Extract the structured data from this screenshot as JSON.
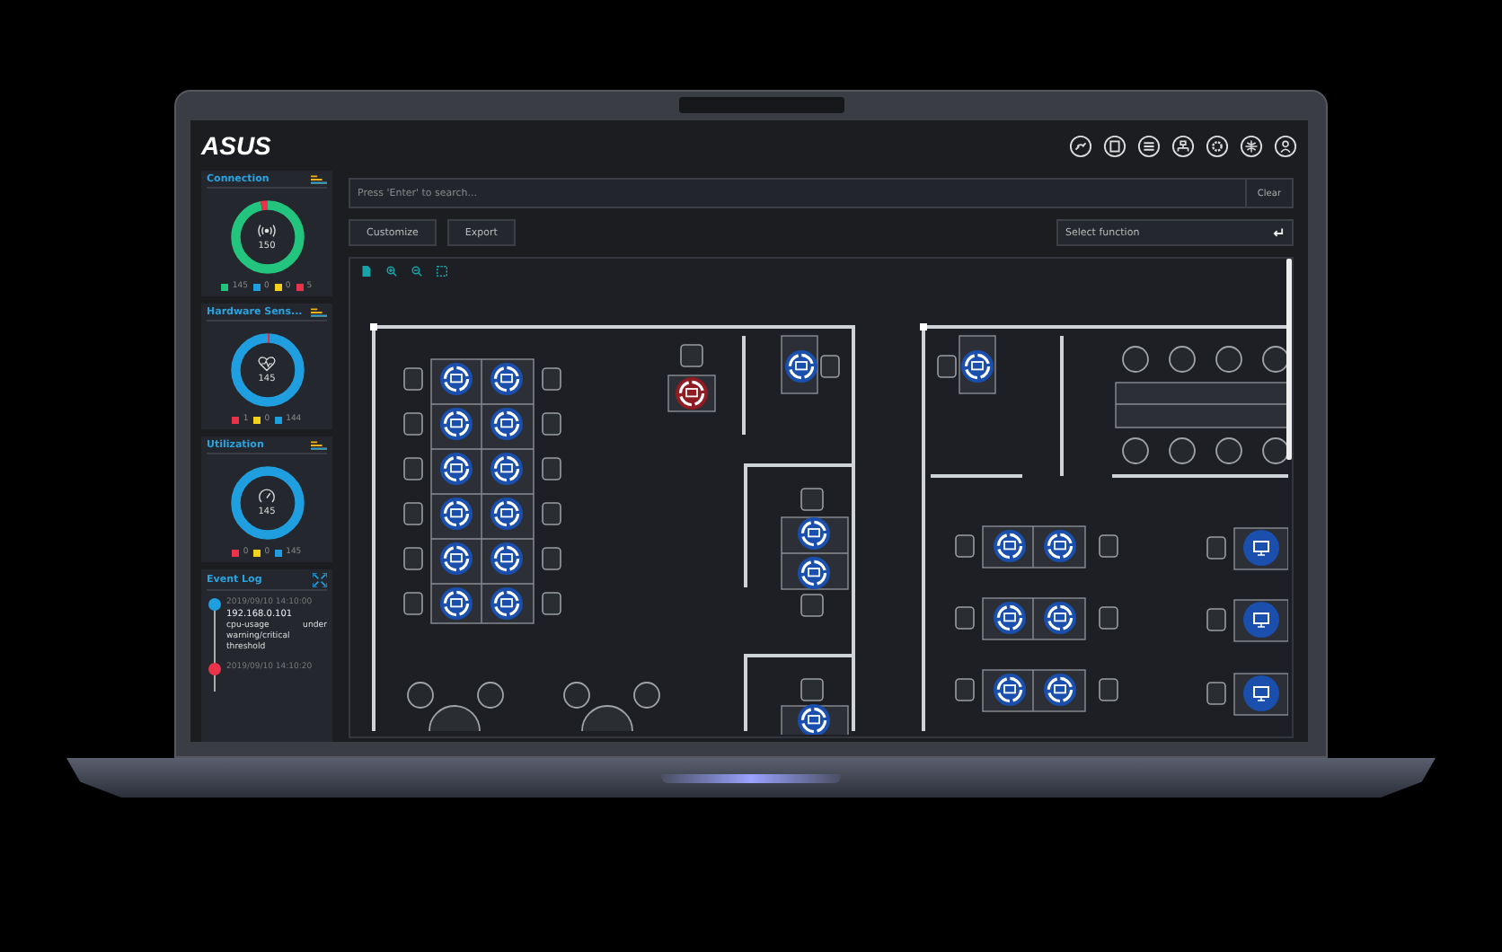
{
  "logo": "ASUS",
  "sidebar": {
    "cards": [
      {
        "kind": "connection",
        "title": "Connection",
        "total": "150",
        "legend": [
          {
            "color": "#22c47e",
            "value": "145"
          },
          {
            "color": "#1f9fe0",
            "value": "0"
          },
          {
            "color": "#f2d21b",
            "value": "0"
          },
          {
            "color": "#e8334a",
            "value": "5"
          }
        ]
      },
      {
        "kind": "hardware",
        "title": "Hardware Sens...",
        "total": "145",
        "legend": [
          {
            "color": "#e8334a",
            "value": "1"
          },
          {
            "color": "#f2d21b",
            "value": "0"
          },
          {
            "color": "#1f9fe0",
            "value": "144"
          }
        ]
      },
      {
        "kind": "utilization",
        "title": "Utilization",
        "total": "145",
        "legend": [
          {
            "color": "#e8334a",
            "value": "0"
          },
          {
            "color": "#f2d21b",
            "value": "0"
          },
          {
            "color": "#1f9fe0",
            "value": "145"
          }
        ]
      }
    ],
    "event_log": {
      "title": "Event Log",
      "events": [
        {
          "color": "#1f9fe0",
          "time": "2019/09/10 14:10:00",
          "host": "192.168.0.101",
          "message": "cpu-usage under warning/critical threshold"
        },
        {
          "color": "#e8334a",
          "time": "2019/09/10 14:10:20"
        }
      ]
    }
  },
  "search": {
    "placeholder": "Press 'Enter' to search...",
    "button": "Clear"
  },
  "buttons": [
    "Customize",
    "Export"
  ],
  "select": {
    "placeholder": "Select function"
  },
  "floor_plan": {
    "devices": [
      {
        "kind": "workstation",
        "alert": false
      },
      {
        "kind": "workstation",
        "alert": false
      },
      {
        "kind": "workstation",
        "alert": false
      },
      {
        "kind": "workstation",
        "alert": false
      },
      {
        "kind": "workstation",
        "alert": false
      },
      {
        "kind": "workstation",
        "alert": false
      },
      {
        "kind": "workstation",
        "alert": false
      },
      {
        "kind": "workstation",
        "alert": false
      },
      {
        "kind": "workstation",
        "alert": false
      },
      {
        "kind": "workstation",
        "alert": false
      },
      {
        "kind": "workstation",
        "alert": false
      },
      {
        "kind": "workstation",
        "alert": false
      },
      {
        "kind": "workstation",
        "alert": true
      },
      {
        "kind": "workstation",
        "alert": false
      },
      {
        "kind": "workstation",
        "alert": false
      },
      {
        "kind": "workstation",
        "alert": false
      },
      {
        "kind": "workstation",
        "alert": false
      },
      {
        "kind": "workstation",
        "alert": false
      },
      {
        "kind": "workstation",
        "alert": false
      },
      {
        "kind": "workstation",
        "alert": false
      },
      {
        "kind": "workstation",
        "alert": false
      },
      {
        "kind": "workstation",
        "alert": false
      },
      {
        "kind": "workstation",
        "alert": false
      },
      {
        "kind": "workstation",
        "alert": false
      },
      {
        "kind": "display",
        "alert": false
      },
      {
        "kind": "display",
        "alert": false
      },
      {
        "kind": "display",
        "alert": false
      }
    ]
  }
}
